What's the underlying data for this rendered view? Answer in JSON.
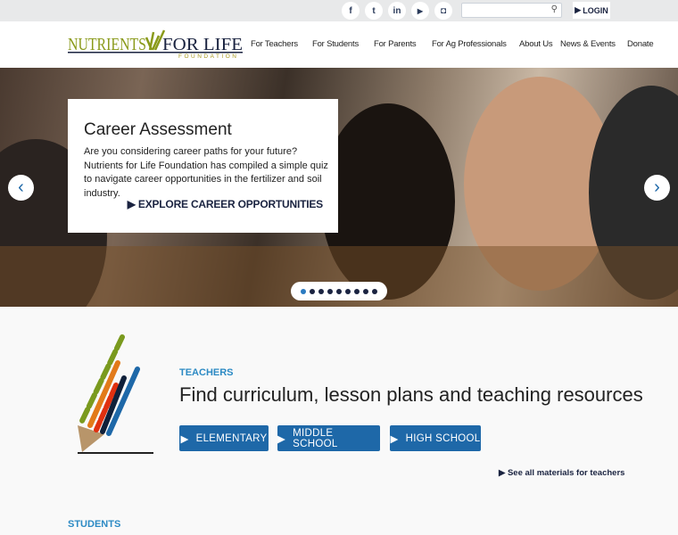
{
  "topbar": {
    "social": [
      {
        "icon": "facebook-icon",
        "glyph": "f"
      },
      {
        "icon": "twitter-icon",
        "glyph": "t"
      },
      {
        "icon": "linkedin-icon",
        "glyph": "in"
      },
      {
        "icon": "youtube-icon",
        "glyph": "▶"
      },
      {
        "icon": "instagram-icon",
        "glyph": "◘"
      }
    ],
    "search_placeholder": "",
    "login": "LOGIN"
  },
  "logo": {
    "text1": "NUTRIENTS",
    "text2": "FOR LIFE",
    "sub": "FOUNDATION"
  },
  "nav": [
    "For Teachers",
    "For Students",
    "For Parents",
    "For Ag Professionals",
    "About Us",
    "News & Events",
    "Donate"
  ],
  "hero": {
    "title": "Career Assessment",
    "body": "Are you considering career paths for your future? Nutrients for Life Foundation has compiled a simple quiz to navigate career opportunities in the fertilizer and soil industry.",
    "cta": "EXPLORE CAREER OPPORTUNITIES",
    "slides": 9,
    "active_slide": 1
  },
  "teachers": {
    "label": "TEACHERS",
    "headline": "Find curriculum, lesson plans and teaching resources",
    "buttons": [
      "ELEMENTARY",
      "MIDDLE SCHOOL",
      "HIGH SCHOOL"
    ],
    "see_all": "See all materials for teachers"
  },
  "students": {
    "label": "STUDENTS"
  },
  "colors": {
    "accent": "#1e68a8",
    "label": "#2c8ac4",
    "dark": "#1a2340",
    "logo_green": "#7a8a1a"
  }
}
